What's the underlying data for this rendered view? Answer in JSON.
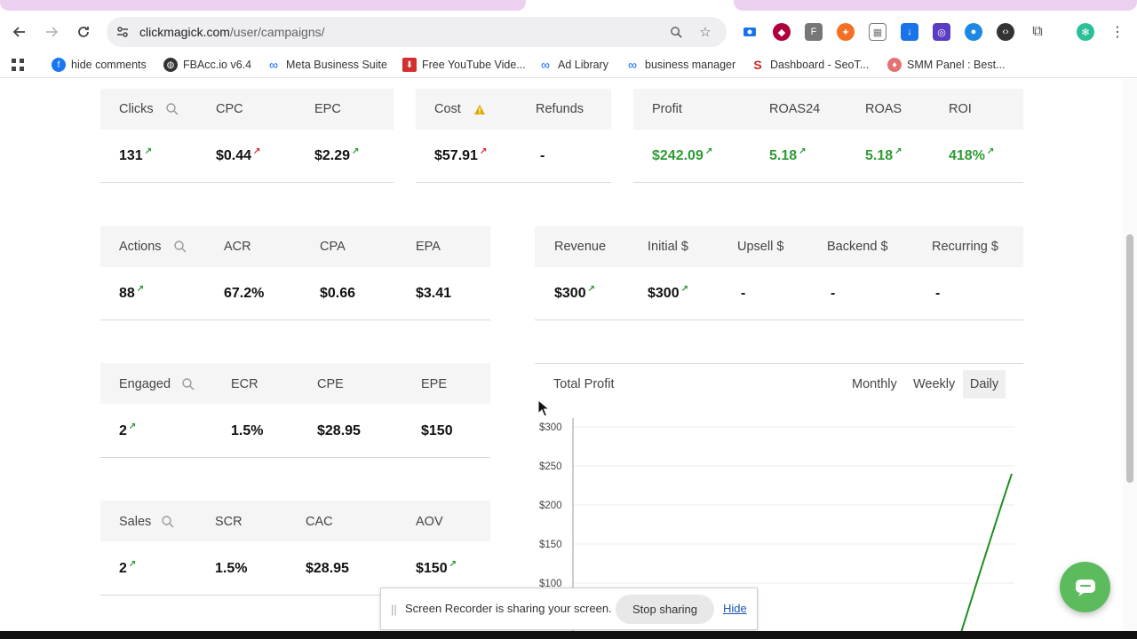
{
  "browser": {
    "url_host": "clickmagick.com",
    "url_path": "/user/campaigns/",
    "bookmarks": [
      {
        "label": "hide comments",
        "icon": "facebook-icon",
        "color": "#1877f2"
      },
      {
        "label": "FBAcc.io v6.4",
        "icon": "globe-icon",
        "color": "#333333"
      },
      {
        "label": "Meta Business Suite",
        "icon": "meta-icon",
        "color": "#0866ff"
      },
      {
        "label": "Free YouTube Vide...",
        "icon": "download-icon",
        "color": "#d32f2f"
      },
      {
        "label": "Ad Library",
        "icon": "meta-icon",
        "color": "#0866ff"
      },
      {
        "label": "business manager",
        "icon": "meta-icon",
        "color": "#0866ff"
      },
      {
        "label": "Dashboard - SeoT...",
        "icon": "seo-icon",
        "color": "#c62828"
      },
      {
        "label": "SMM Panel : Best...",
        "icon": "smm-icon",
        "color": "#e57373"
      }
    ]
  },
  "metrics_row1": {
    "left": [
      {
        "label": "Clicks",
        "value": "131",
        "arrow": "green",
        "search": true
      },
      {
        "label": "CPC",
        "value": "$0.44",
        "arrow": "red"
      },
      {
        "label": "EPC",
        "value": "$2.29",
        "arrow": "green"
      }
    ],
    "middle": [
      {
        "label": "Cost",
        "value": "$57.91",
        "arrow": "red",
        "warning": true
      },
      {
        "label": "Refunds",
        "value": "-"
      }
    ],
    "right": [
      {
        "label": "Profit",
        "value": "$242.09",
        "arrow": "green"
      },
      {
        "label": "ROAS24",
        "value": "5.18",
        "arrow": "green"
      },
      {
        "label": "ROAS",
        "value": "5.18",
        "arrow": "green"
      },
      {
        "label": "ROI",
        "value": "418%",
        "arrow": "green"
      }
    ]
  },
  "metrics_actions": [
    {
      "label": "Actions",
      "value": "88",
      "arrow": "green",
      "search": true
    },
    {
      "label": "ACR",
      "value": "67.2%"
    },
    {
      "label": "CPA",
      "value": "$0.66"
    },
    {
      "label": "EPA",
      "value": "$3.41"
    }
  ],
  "metrics_revenue": [
    {
      "label": "Revenue",
      "value": "$300",
      "arrow": "green"
    },
    {
      "label": "Initial $",
      "value": "$300",
      "arrow": "green"
    },
    {
      "label": "Upsell $",
      "value": "-"
    },
    {
      "label": "Backend $",
      "value": "-"
    },
    {
      "label": "Recurring $",
      "value": "-"
    }
  ],
  "metrics_engaged": [
    {
      "label": "Engaged",
      "value": "2",
      "arrow": "green",
      "search": true
    },
    {
      "label": "ECR",
      "value": "1.5%"
    },
    {
      "label": "CPE",
      "value": "$28.95"
    },
    {
      "label": "EPE",
      "value": "$150"
    }
  ],
  "metrics_sales": [
    {
      "label": "Sales",
      "value": "2",
      "arrow": "green",
      "search": true
    },
    {
      "label": "SCR",
      "value": "1.5%"
    },
    {
      "label": "CAC",
      "value": "$28.95"
    },
    {
      "label": "AOV",
      "value": "$150",
      "arrow": "green"
    }
  ],
  "chart": {
    "title": "Total Profit",
    "tabs": [
      "Monthly",
      "Weekly",
      "Daily"
    ],
    "active_tab": "Daily"
  },
  "chart_data": {
    "type": "line",
    "title": "Total Profit",
    "ylabel": "",
    "xlabel": "",
    "ytick_labels": [
      "$300",
      "$250",
      "$200",
      "$150",
      "$100"
    ],
    "ylim": [
      0,
      300
    ],
    "series": [
      {
        "values_visible_end": [
          0,
          240
        ]
      }
    ],
    "line_color": "#1e8f1e",
    "grid": true
  },
  "share_bar": {
    "message": "Screen Recorder is sharing your screen.",
    "stop_label": "Stop sharing",
    "hide_label": "Hide"
  },
  "colors": {
    "positive": "#2e9b34",
    "negative": "#d32f2f",
    "header_bg": "#f5f5f5",
    "fab": "#5cbb5c"
  }
}
